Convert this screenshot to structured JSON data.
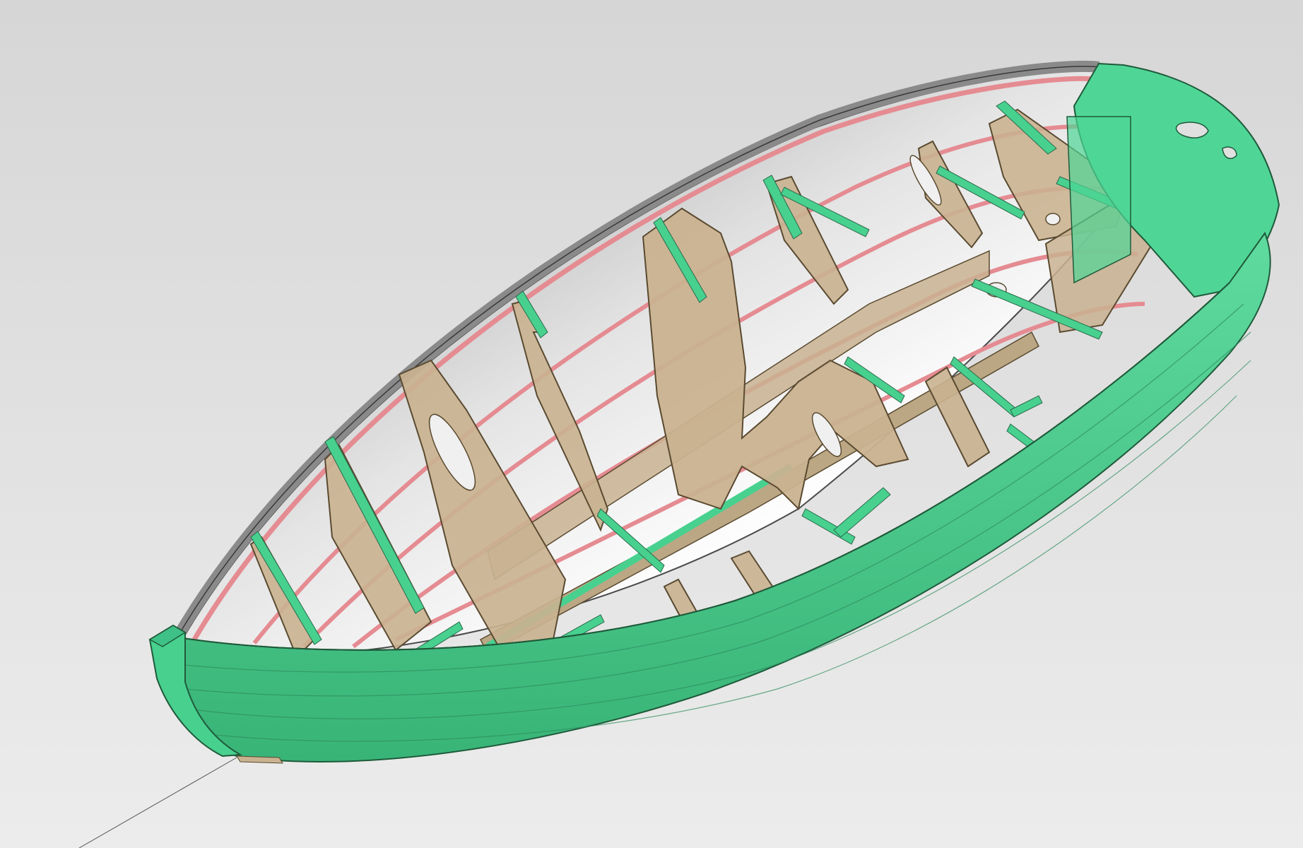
{
  "viewport": {
    "background_top": "#d6d6d6",
    "background_bottom": "#ececec"
  },
  "model": {
    "parts": [
      {
        "name": "hull-planking",
        "color": "#4fd696"
      },
      {
        "name": "transom",
        "color": "#4fd696"
      },
      {
        "name": "stem",
        "color": "#4fd696"
      },
      {
        "name": "inner-hull-surface",
        "color": "#b4b4b4"
      },
      {
        "name": "gunwale-rail",
        "color": "#e58b92"
      },
      {
        "name": "stringers",
        "color": "#e58b92"
      },
      {
        "name": "bulkheads-frames",
        "color": "#c9b290"
      },
      {
        "name": "floor-stringers-cleats",
        "color": "#48d08f"
      },
      {
        "name": "keel-backbone",
        "color": "#bba784"
      }
    ],
    "frame_count": 9,
    "stringer_count": 4
  }
}
